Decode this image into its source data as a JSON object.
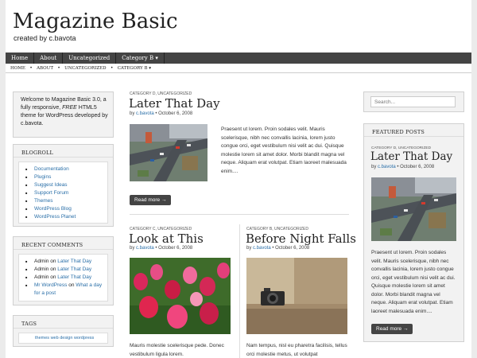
{
  "site": {
    "title": "Magazine Basic",
    "description": "created by c.bavota"
  },
  "nav": {
    "items": [
      "Home",
      "About",
      "Uncategorized",
      "Category B ▾"
    ]
  },
  "subnav": {
    "items": [
      "Home",
      "About",
      "Uncategorized",
      "Category B ▾"
    ]
  },
  "left": {
    "welcome": {
      "parts": [
        "Welcome to Magazine Basic 3.0, a fully responsive, ",
        "FREE",
        " HTML5 theme for WordPress developed by c.bavota."
      ]
    },
    "blogroll": {
      "title": "BLOGROLL",
      "items": [
        "Documentation",
        "Plugins",
        "Suggest Ideas",
        "Support Forum",
        "Themes",
        "WordPress Blog",
        "WordPress Planet"
      ]
    },
    "recent_comments": {
      "title": "RECENT COMMENTS",
      "items": [
        {
          "author": "Admin",
          "on": "on",
          "post": "Later That Day"
        },
        {
          "author": "Admin",
          "on": "on",
          "post": "Later That Day"
        },
        {
          "author": "Admin",
          "on": "on",
          "post": "Later That Day"
        },
        {
          "author": "Mr WordPress",
          "on": "on",
          "post": "What a day for a post"
        }
      ]
    },
    "tags": {
      "title": "TAGS",
      "items": [
        "themes",
        "web design",
        "wordpress"
      ]
    }
  },
  "posts": {
    "featured": {
      "category": "CATEGORY D, UNCATEGORIZED",
      "title": "Later That Day",
      "by": "by",
      "author": "c.bavota",
      "date": "• October 6, 2008",
      "excerpt": "Praesent ut lorem. Proin sodales velit. Mauris scelerisque, nibh nec convallis lacinia, lorem justo congue orci, eget vestibulum nisi velit ac dui. Quisque molestie lorem sit amet dolor. Morbi blandit magna vel neque. Aliquam erat volutpat. Etiam laoreet malesuada enim....",
      "read_more": "Read more →"
    },
    "left": {
      "category": "CATEGORY C, UNCATEGORIZED",
      "title": "Look at This",
      "by": "by",
      "author": "c.bavota",
      "date": "• October 6, 2008",
      "excerpt": "Mauris molestie scelerisque pede. Donec vestibulum ligula lorem."
    },
    "right": {
      "category": "CATEGORY B, UNCATEGORIZED",
      "title": "Before Night Falls",
      "by": "by",
      "author": "c.bavota",
      "date": "• October 6, 2008",
      "excerpt": "Nam tempus, nisl eu pharetra facilisis, tellus orci molestie metus, ut volutpat"
    }
  },
  "right": {
    "search": {
      "placeholder": "Search..."
    },
    "featured": {
      "title": "FEATURED POSTS",
      "category": "CATEGORY D, UNCATEGORIZED",
      "post_title": "Later That Day",
      "by": "by",
      "author": "c.bavota",
      "date": "• October 6, 2008",
      "excerpt": "Praesent ut lorem. Proin sodales velit. Mauris scelerisque, nibh nec convallis lacinia, lorem justo congue orci, eget vestibulum nisi velit ac dui. Quisque molestie lorem sit amet dolor. Morbi blandit magna vel neque. Aliquam erat volutpat. Etiam laoreet malesuada enim....",
      "read_more": "Read more →"
    }
  },
  "colors": {
    "link": "#2a6fa8",
    "nav_bg": "#444444",
    "page_bg": "#ebebeb"
  }
}
